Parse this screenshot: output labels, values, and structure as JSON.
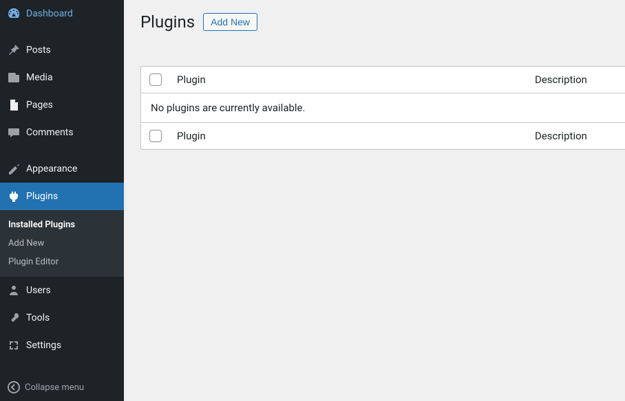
{
  "sidebar": {
    "dashboard": "Dashboard",
    "posts": "Posts",
    "media": "Media",
    "pages": "Pages",
    "comments": "Comments",
    "appearance": "Appearance",
    "plugins": "Plugins",
    "users": "Users",
    "tools": "Tools",
    "settings": "Settings",
    "collapse": "Collapse menu",
    "submenu": {
      "installed": "Installed Plugins",
      "add_new": "Add New",
      "editor": "Plugin Editor"
    }
  },
  "page": {
    "title": "Plugins",
    "add_new_button": "Add New"
  },
  "table": {
    "col_plugin": "Plugin",
    "col_description": "Description",
    "empty_message": "No plugins are currently available."
  }
}
